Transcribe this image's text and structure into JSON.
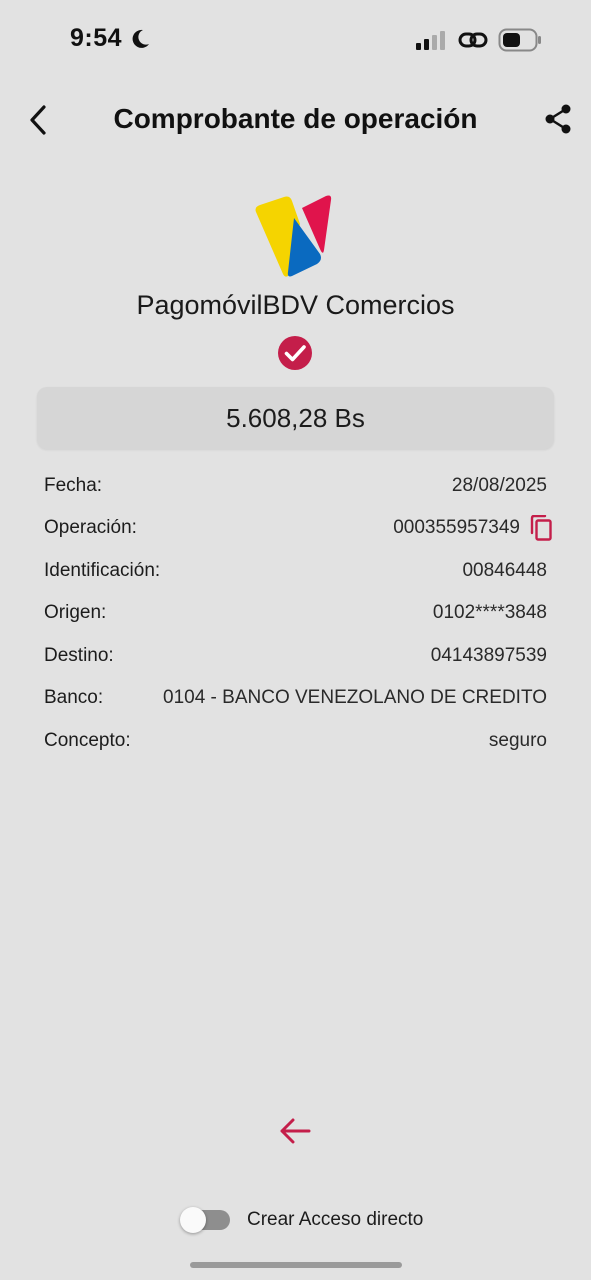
{
  "status_bar": {
    "time": "9:54"
  },
  "header": {
    "title": "Comprobante de operación"
  },
  "brand": {
    "name": "PagomóvilBDV Comercios"
  },
  "amount": "5.608,28 Bs",
  "details": [
    {
      "label": "Fecha:",
      "value": "28/08/2025"
    },
    {
      "label": "Operación:",
      "value": "000355957349"
    },
    {
      "label": "Identificación:",
      "value": "00846448"
    },
    {
      "label": "Origen:",
      "value": "0102****3848"
    },
    {
      "label": "Destino:",
      "value": "04143897539"
    },
    {
      "label": "Banco:",
      "value": "0104 - BANCO VENEZOLANO DE CREDITO"
    },
    {
      "label": "Concepto:",
      "value": "seguro"
    }
  ],
  "shortcut": {
    "label": "Crear Acceso directo",
    "enabled": false
  },
  "colors": {
    "accent": "#c41e4a",
    "background": "#e2e2e2",
    "logo_yellow": "#f5d400",
    "logo_red": "#e0144c",
    "logo_blue": "#0a6ac0"
  },
  "icons": [
    "moon-icon",
    "signal-icon",
    "link-icon",
    "battery-icon",
    "back-arrow-icon",
    "share-icon",
    "check-circle-icon",
    "copy-icon",
    "arrow-left-icon"
  ]
}
